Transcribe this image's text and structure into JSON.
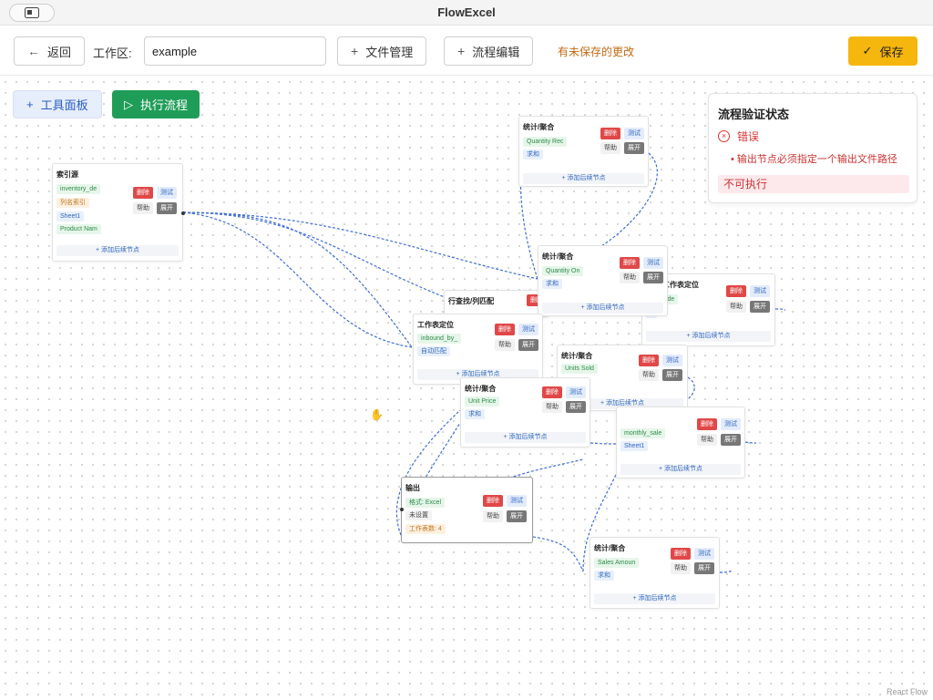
{
  "app": {
    "title": "FlowExcel"
  },
  "toolbar": {
    "back_label": "返回",
    "workspace_label": "工作区:",
    "workspace_value": "example",
    "file_manage_label": "文件管理",
    "flow_edit_label": "流程编辑",
    "unsaved_text": "有未保存的更改",
    "save_label": "保存"
  },
  "canvas": {
    "tools_label": "工具面板",
    "run_label": "执行流程",
    "attribution": "React Flow"
  },
  "validation": {
    "title": "流程验证状态",
    "error_label": "错误",
    "messages": [
      "输出节点必须指定一个输出文件路径"
    ],
    "status": "不可执行"
  },
  "node_buttons": {
    "delete": "删除",
    "test": "测试",
    "help": "帮助",
    "expand": "展开",
    "add_next": "+ 添加后续节点"
  },
  "nodes": {
    "index_source": {
      "title": "索引源",
      "tags": [
        "inventory_de",
        "列名索引",
        "Sheet1",
        "Product Nam"
      ]
    },
    "agg_top": {
      "title": "统计/聚合",
      "tags": [
        "Quantity Rec",
        "求和"
      ]
    },
    "agg_mid": {
      "title": "统计/聚合",
      "tags": [
        "Quantity On",
        "求和"
      ]
    },
    "sheet_right": {
      "title": "工作表定位",
      "tags": [
        "ntory_de",
        "1"
      ]
    },
    "lookup": {
      "title": "行查找/列匹配"
    },
    "sheet_main": {
      "title": "工作表定位",
      "tags": [
        "inbound_by_",
        "自动匹配"
      ]
    },
    "agg_units": {
      "title": "统计/聚合",
      "tags": [
        "Units Sold"
      ]
    },
    "agg_price": {
      "title": "统计/聚合",
      "tags": [
        "Unit Price",
        "求和"
      ]
    },
    "sheet_monthly": {
      "tags": [
        "monthly_sale",
        "Sheet1"
      ]
    },
    "output": {
      "title": "输出",
      "tags": [
        "格式: Excel",
        "未设置",
        "工作表数: 4"
      ]
    },
    "agg_sales": {
      "title": "统计/聚合",
      "tags": [
        "Sales Amoun",
        "求和"
      ]
    }
  },
  "colors": {
    "accent_blue": "#2a5cc9",
    "run_green": "#1f9d58",
    "save_yellow": "#f5b60d",
    "error_red": "#d33",
    "delete_red": "#e04848"
  },
  "icons": {
    "back": "arrow-left-icon",
    "plus": "plus-icon",
    "check": "check-icon",
    "play": "play-icon",
    "error": "circle-x-icon",
    "hand": "hand-cursor-icon"
  }
}
